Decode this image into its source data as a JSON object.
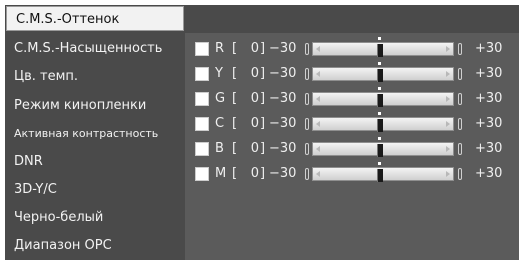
{
  "menu": {
    "items": [
      {
        "label": "C.M.S.-Оттенок",
        "selected": true
      },
      {
        "label": "C.M.S.-Насыщенность"
      },
      {
        "label": "Цв. темп."
      },
      {
        "label": "Режим кинопленки"
      },
      {
        "label": "Активная контрастность"
      },
      {
        "label": "DNR"
      },
      {
        "label": "3D-Y/C"
      },
      {
        "label": "Черно-белый"
      },
      {
        "label": "Диапазон OPC"
      }
    ]
  },
  "panel": {
    "rows": [
      {
        "channel": "R",
        "bracket_open": "[",
        "value": "0",
        "bracket_close": "]",
        "min": "−30",
        "max": "+30",
        "level": 0
      },
      {
        "channel": "Y",
        "bracket_open": "[",
        "value": "0",
        "bracket_close": "]",
        "min": "−30",
        "max": "+30",
        "level": 0
      },
      {
        "channel": "G",
        "bracket_open": "[",
        "value": "0",
        "bracket_close": "]",
        "min": "−30",
        "max": "+30",
        "level": 0
      },
      {
        "channel": "C",
        "bracket_open": "[",
        "value": "0",
        "bracket_close": "]",
        "min": "−30",
        "max": "+30",
        "level": 0
      },
      {
        "channel": "B",
        "bracket_open": "[",
        "value": "0",
        "bracket_close": "]",
        "min": "−30",
        "max": "+30",
        "level": 0
      },
      {
        "channel": "M",
        "bracket_open": "[",
        "value": "0",
        "bracket_close": "]",
        "min": "−30",
        "max": "+30",
        "level": 0
      }
    ]
  },
  "colors": {
    "menu_bg": "#4a4a4a",
    "panel_bg": "#5b5b5b",
    "selected_bg": "#f2f2f2",
    "text": "#efefef"
  }
}
